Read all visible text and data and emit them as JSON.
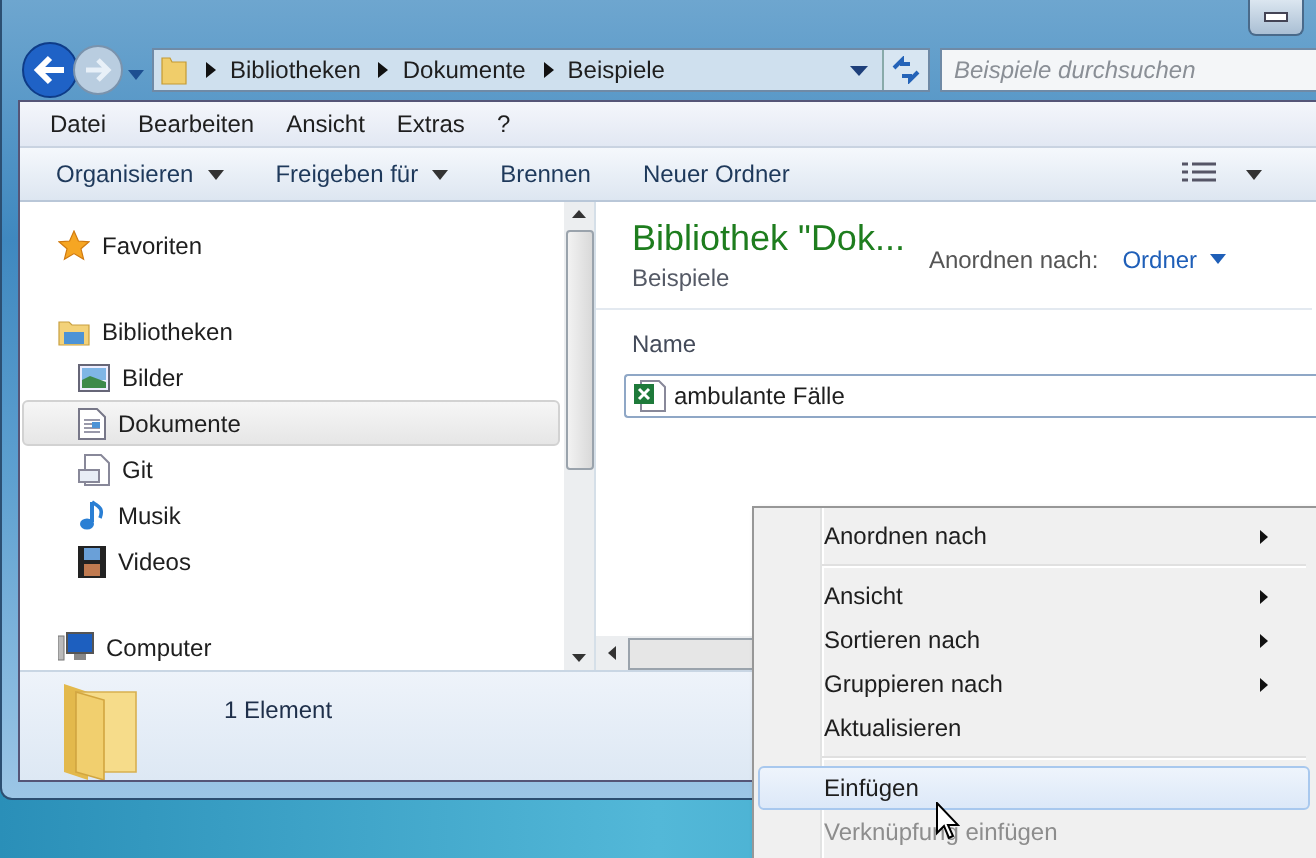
{
  "address": [
    "Bibliotheken",
    "Dokumente",
    "Beispiele"
  ],
  "search": {
    "placeholder": "Beispiele durchsuchen"
  },
  "menu": [
    "Datei",
    "Bearbeiten",
    "Ansicht",
    "Extras",
    "?"
  ],
  "toolbar": [
    {
      "label": "Organisieren",
      "dropdown": true
    },
    {
      "label": "Freigeben für",
      "dropdown": true
    },
    {
      "label": "Brennen",
      "dropdown": false
    },
    {
      "label": "Neuer Ordner",
      "dropdown": false
    }
  ],
  "nav": [
    {
      "label": "Favoriten",
      "kind": "star",
      "selected": false
    },
    {
      "label": "Bibliotheken",
      "kind": "library",
      "selected": false,
      "children": [
        {
          "label": "Bilder",
          "kind": "pictures",
          "selected": false
        },
        {
          "label": "Dokumente",
          "kind": "documents",
          "selected": true
        },
        {
          "label": "Git",
          "kind": "git",
          "selected": false
        },
        {
          "label": "Musik",
          "kind": "music",
          "selected": false
        },
        {
          "label": "Videos",
          "kind": "videos",
          "selected": false
        }
      ]
    },
    {
      "label": "Computer",
      "kind": "computer",
      "selected": false
    }
  ],
  "content": {
    "title": "Bibliothek \"Dok...",
    "subtitle": "Beispiele",
    "arrange_label": "Anordnen nach:",
    "arrange_value": "Ordner",
    "column": "Name",
    "files": [
      {
        "name": "ambulante Fälle",
        "selected": false
      }
    ]
  },
  "status": "1 Element",
  "context_menu": [
    {
      "kind": "item",
      "label": "Anordnen nach",
      "submenu": true,
      "disabled": false,
      "selected": false
    },
    {
      "kind": "separator"
    },
    {
      "kind": "item",
      "label": "Ansicht",
      "submenu": true,
      "disabled": false,
      "selected": false
    },
    {
      "kind": "item",
      "label": "Sortieren nach",
      "submenu": true,
      "disabled": false,
      "selected": false
    },
    {
      "kind": "item",
      "label": "Gruppieren nach",
      "submenu": true,
      "disabled": false,
      "selected": false
    },
    {
      "kind": "item",
      "label": "Aktualisieren",
      "submenu": false,
      "disabled": false,
      "selected": false
    },
    {
      "kind": "separator"
    },
    {
      "kind": "item",
      "label": "Einfügen",
      "submenu": false,
      "disabled": false,
      "selected": true
    },
    {
      "kind": "item",
      "label": "Verknüpfung einfügen",
      "submenu": false,
      "disabled": true,
      "selected": false
    }
  ]
}
